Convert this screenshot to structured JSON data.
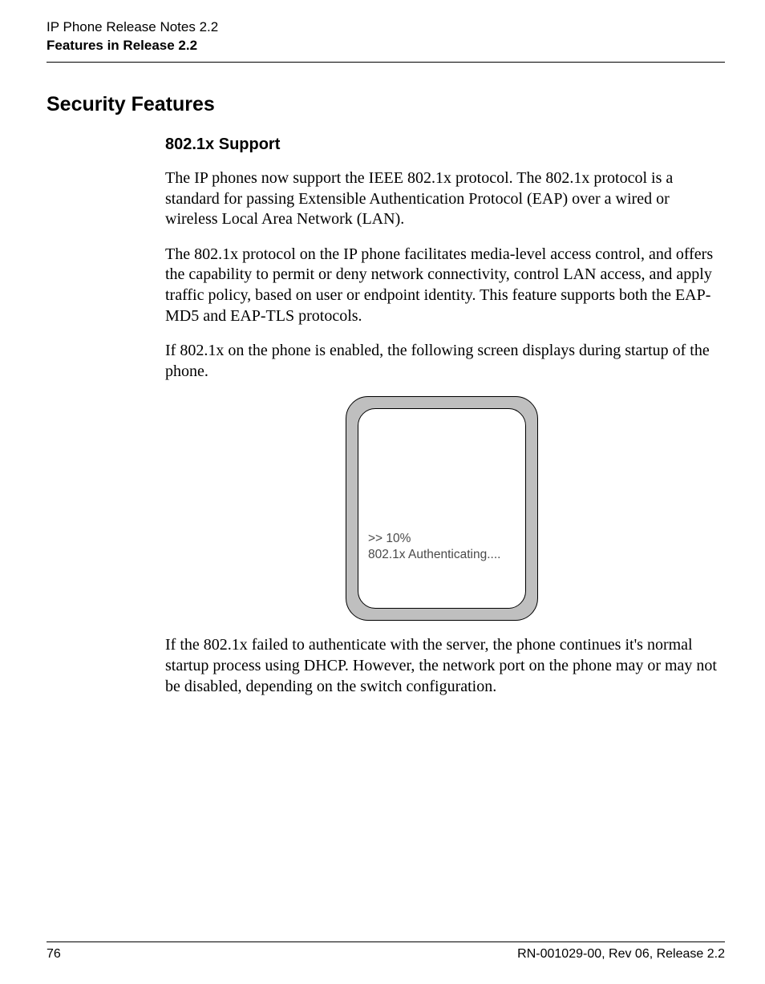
{
  "header": {
    "line1": "IP Phone Release Notes 2.2",
    "line2": "Features in Release 2.2"
  },
  "h1": "Security Features",
  "h2": "802.1x Support",
  "para1": "The IP phones now support the IEEE 802.1x protocol. The 802.1x protocol is a standard for passing Extensible Authentication Protocol (EAP) over a wired or wireless Local Area Network (LAN).",
  "para2": "The 802.1x protocol on the IP phone facilitates media-level access control, and offers the capability to permit or deny network connectivity, control LAN access, and apply traffic policy, based on user or endpoint identity. This feature supports both the EAP-MD5 and EAP-TLS protocols.",
  "para3": "If 802.1x on the phone is enabled, the following screen displays during startup of the phone.",
  "screen": {
    "line1": ">> 10%",
    "line2": "802.1x Authenticating...."
  },
  "para4": "If the 802.1x failed to authenticate with the server, the phone continues it's normal startup process using DHCP. However, the network port on the phone may or may not be disabled, depending on the switch configuration.",
  "footer": {
    "page": "76",
    "doc": "RN-001029-00, Rev 06, Release 2.2"
  }
}
